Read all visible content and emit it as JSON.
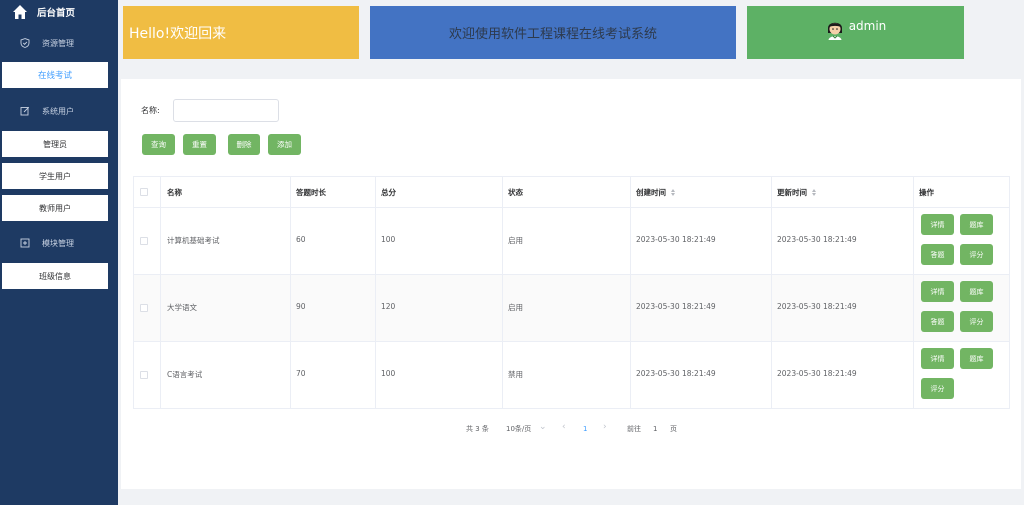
{
  "sidebar": {
    "home_label": "后台首页",
    "groups": [
      {
        "label": "资源管理",
        "icon": "shield-icon"
      },
      {
        "label": "系统用户",
        "icon": "edit-icon"
      },
      {
        "label": "模块管理",
        "icon": "box-icon"
      }
    ],
    "items": [
      "在线考试",
      "管理员",
      "学生用户",
      "教师用户",
      "班级信息"
    ],
    "active_item": "在线考试"
  },
  "banners": {
    "hello": "Hello!欢迎回来",
    "welcome": "欢迎使用软件工程课程在线考试系统",
    "username": "admin"
  },
  "search": {
    "label": "名称:",
    "value": "",
    "placeholder": ""
  },
  "toolbar": {
    "query": "查询",
    "reset": "重置",
    "delete": "删除",
    "add": "添加"
  },
  "table": {
    "columns": [
      "名称",
      "答题时长",
      "总分",
      "状态",
      "创建时间",
      "更新时间",
      "操作"
    ],
    "rows": [
      {
        "name": "计算机基础考试",
        "duration": "60",
        "score": "100",
        "status": "启用",
        "created": "2023-05-30 18:21:49",
        "updated": "2023-05-30 18:21:49",
        "ops": [
          "详情",
          "题库",
          "答题",
          "评分"
        ]
      },
      {
        "name": "大学语文",
        "duration": "90",
        "score": "120",
        "status": "启用",
        "created": "2023-05-30 18:21:49",
        "updated": "2023-05-30 18:21:49",
        "ops": [
          "详情",
          "题库",
          "答题",
          "评分"
        ]
      },
      {
        "name": "C语言考试",
        "duration": "70",
        "score": "100",
        "status": "禁用",
        "created": "2023-05-30 18:21:49",
        "updated": "2023-05-30 18:21:49",
        "ops": [
          "详情",
          "题库",
          "评分"
        ]
      }
    ]
  },
  "pagination": {
    "total": "共 3 条",
    "page_size": "10条/页",
    "current_page": "1",
    "goto_prefix": "前往",
    "goto_value": "1",
    "goto_suffix": "页"
  },
  "colors": {
    "sidebar_bg": "#1e3a63",
    "hello_banner": "#f0bd43",
    "welcome_banner": "#4373c3",
    "user_banner": "#5db165",
    "button_green": "#72b563",
    "active_link": "#409eff"
  }
}
